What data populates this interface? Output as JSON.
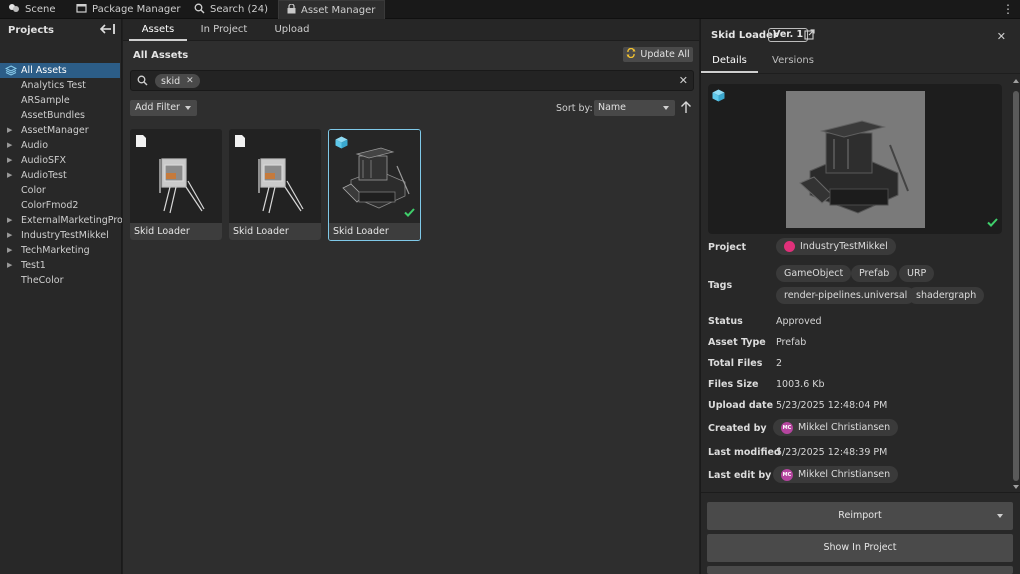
{
  "top_tabs": [
    {
      "label": "Scene",
      "icon": "unity-logo-icon"
    },
    {
      "label": "Package Manager",
      "icon": "package-icon"
    },
    {
      "label": "Search (24)",
      "icon": "search-icon"
    },
    {
      "label": "Asset Manager",
      "icon": "lock-icon",
      "active": true
    }
  ],
  "sidebar": {
    "title": "Projects",
    "items": [
      {
        "label": "All Assets",
        "selected": true,
        "expandable": false
      },
      {
        "label": "Analytics Test",
        "expandable": false
      },
      {
        "label": "ARSample",
        "expandable": false
      },
      {
        "label": "AssetBundles",
        "expandable": false
      },
      {
        "label": "AssetManager",
        "expandable": true
      },
      {
        "label": "Audio",
        "expandable": true
      },
      {
        "label": "AudioSFX",
        "expandable": true
      },
      {
        "label": "AudioTest",
        "expandable": true
      },
      {
        "label": "Color",
        "expandable": false
      },
      {
        "label": "ColorFmod2",
        "expandable": false
      },
      {
        "label": "ExternalMarketingProje",
        "expandable": true
      },
      {
        "label": "IndustryTestMikkel",
        "expandable": true
      },
      {
        "label": "TechMarketing",
        "expandable": true
      },
      {
        "label": "Test1",
        "expandable": true
      },
      {
        "label": "TheColor",
        "expandable": false
      }
    ]
  },
  "main": {
    "tabs": [
      "Assets",
      "In Project",
      "Upload"
    ],
    "active_tab": "Assets",
    "title": "All Assets",
    "update_all_label": "Update All",
    "search_chip": "skid",
    "add_filter_label": "Add Filter",
    "sort_by_label": "Sort by:",
    "sort_value": "Name",
    "assets": [
      {
        "name": "Skid Loader",
        "type_icon": "document-icon",
        "selected": false,
        "imported": false
      },
      {
        "name": "Skid Loader",
        "type_icon": "document-icon",
        "selected": false,
        "imported": false
      },
      {
        "name": "Skid Loader",
        "type_icon": "prefab-cube-icon",
        "selected": true,
        "imported": true
      }
    ]
  },
  "details": {
    "title": "Skid Loader",
    "version": "Ver. 1",
    "tabs": [
      "Details",
      "Versions"
    ],
    "active_tab": "Details",
    "project_label": "Project",
    "project": "IndustryTestMikkel",
    "tags_label": "Tags",
    "tags": [
      "GameObject",
      "Prefab",
      "URP",
      "render-pipelines.universal",
      "shadergraph"
    ],
    "status_label": "Status",
    "status": "Approved",
    "asset_type_label": "Asset Type",
    "asset_type": "Prefab",
    "total_files_label": "Total Files",
    "total_files": "2",
    "files_size_label": "Files Size",
    "files_size": "1003.6 Kb",
    "upload_date_label": "Upload date",
    "upload_date": "5/23/2025 12:48:04 PM",
    "created_by_label": "Created by",
    "created_by": "Mikkel Christiansen",
    "created_by_initials": "MC",
    "last_modified_label": "Last modified",
    "last_modified": "5/23/2025 12:48:39 PM",
    "last_edit_by_label": "Last edit by",
    "last_edit_by": "Mikkel Christiansen",
    "last_edit_by_initials": "MC",
    "reimport_label": "Reimport",
    "show_in_project_label": "Show In Project"
  },
  "colors": {
    "accent_selection": "#2c5d87",
    "card_selected_border": "#7fc9e8",
    "success_check": "#3fcf6b",
    "prefab_cube": "#5ec8ea",
    "project_icon": "#e0307a",
    "avatar": "#b5459f"
  }
}
